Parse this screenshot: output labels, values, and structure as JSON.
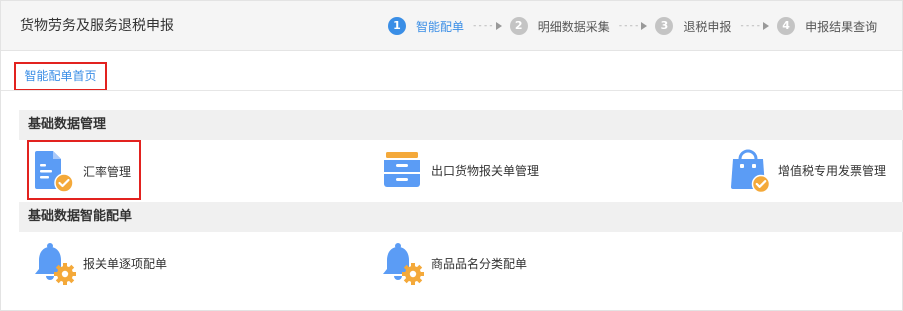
{
  "header": {
    "title": "货物劳务及服务退税申报",
    "steps": [
      {
        "num": "1",
        "label": "智能配单",
        "active": true
      },
      {
        "num": "2",
        "label": "明细数据采集",
        "active": false
      },
      {
        "num": "3",
        "label": "退税申报",
        "active": false
      },
      {
        "num": "4",
        "label": "申报结果查询",
        "active": false
      }
    ],
    "arrow_dash": "----"
  },
  "tab": {
    "label": "智能配单首页"
  },
  "sections": [
    {
      "title": "基础数据管理",
      "items": [
        {
          "label": "汇率管理",
          "icon": "exchange-rate-doc-icon"
        },
        {
          "label": "出口货物报关单管理",
          "icon": "cabinet-drawer-icon"
        },
        {
          "label": "增值税专用发票管理",
          "icon": "shopping-bag-icon"
        }
      ]
    },
    {
      "title": "基础数据智能配单",
      "items": [
        {
          "label": "报关单逐项配单",
          "icon": "bell-gear-icon"
        },
        {
          "label": "商品品名分类配单",
          "icon": "bell-gear-icon"
        }
      ]
    }
  ],
  "colors": {
    "accent": "#3a8ee6",
    "highlight": "#e2221f",
    "icon_blue": "#5b9cf5",
    "icon_orange": "#f4a93a"
  }
}
